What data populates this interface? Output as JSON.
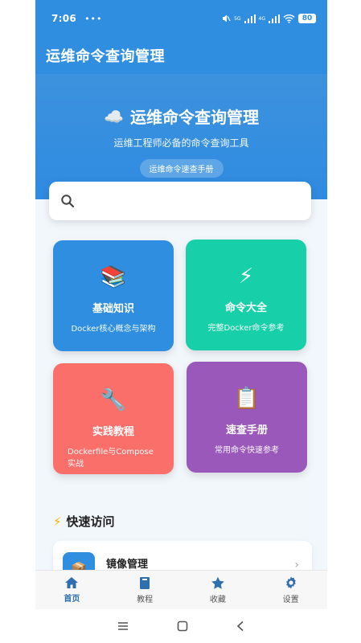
{
  "status_bar": {
    "time": "7:06",
    "dots": "•••",
    "battery": "80",
    "net_label_1": "5G",
    "net_label_2": "4G"
  },
  "app_bar": {
    "title": "运维命令查询管理"
  },
  "hero": {
    "icon": "cloud-icon",
    "title": "运维命令查询管理",
    "subtitle": "运维工程师必备的命令查询工具",
    "pill": "运维命令速查手册"
  },
  "search": {
    "placeholder": "",
    "value": ""
  },
  "cards": [
    {
      "icon": "books-icon",
      "glyph": "📚",
      "title": "基础知识",
      "desc": "Docker核心概念与架构",
      "color": "#2f8ee0"
    },
    {
      "icon": "lightning-icon",
      "glyph": "⚡",
      "title": "命令大全",
      "desc": "完整Docker命令参考",
      "color": "#17cfa9"
    },
    {
      "icon": "wrench-icon",
      "glyph": "🔧",
      "title": "实践教程",
      "desc": "Dockerfile与Compose实战",
      "color": "#fb6f6a"
    },
    {
      "icon": "clipboard-icon",
      "glyph": "📋",
      "title": "速查手册",
      "desc": "常用命令快速参考",
      "color": "#9a58bb"
    }
  ],
  "quick_access": {
    "heading": "快速访问",
    "items": [
      {
        "icon": "package-icon",
        "label": "镜像管理"
      }
    ]
  },
  "bottom_nav": [
    {
      "icon": "home-icon",
      "label": "首页",
      "active": true
    },
    {
      "icon": "book-icon",
      "label": "教程",
      "active": false
    },
    {
      "icon": "star-icon",
      "label": "收藏",
      "active": false
    },
    {
      "icon": "gear-icon",
      "label": "设置",
      "active": false
    }
  ],
  "colors": {
    "primary": "#2f8ee0",
    "teal": "#17cfa9",
    "coral": "#fb6f6a",
    "purple": "#9a58bb"
  }
}
